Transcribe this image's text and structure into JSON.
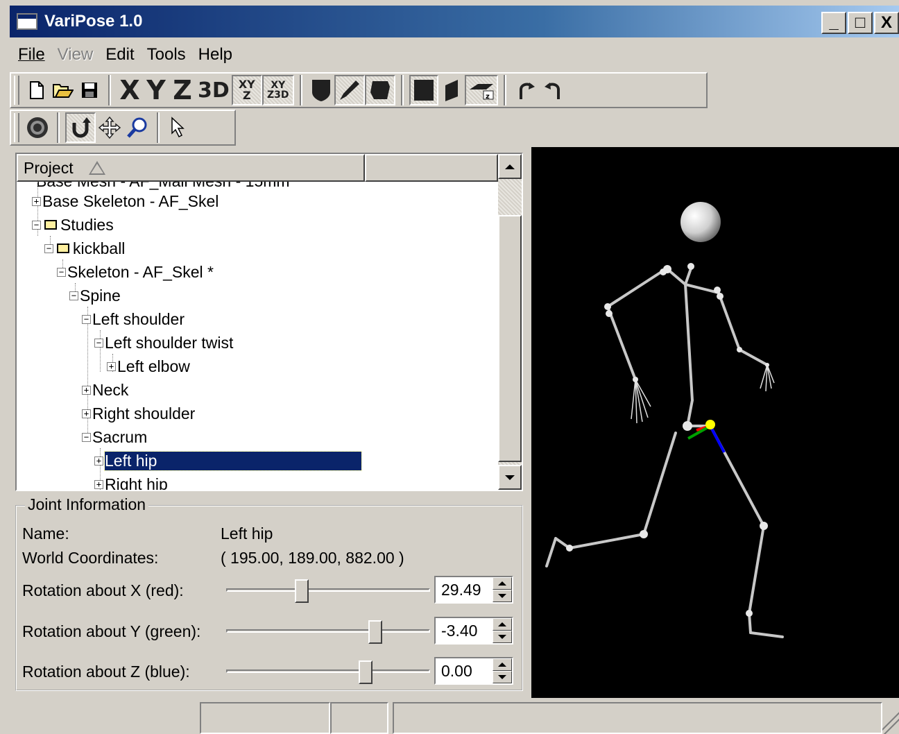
{
  "window": {
    "title": "VariPose 1.0",
    "controls": {
      "minimize": "_",
      "maximize": "□",
      "close": "X"
    }
  },
  "menu": {
    "items": [
      {
        "label": "File",
        "enabled": true
      },
      {
        "label": "View",
        "enabled": false
      },
      {
        "label": "Edit",
        "enabled": true
      },
      {
        "label": "Tools",
        "enabled": true
      },
      {
        "label": "Help",
        "enabled": true
      }
    ]
  },
  "toolbar1": {
    "axis_x": "X",
    "axis_y": "Y",
    "axis_z": "Z",
    "view_3d": "3D",
    "xy_z": "XY Z",
    "xy_3d": "XY Z3D",
    "icons": [
      "new-file-icon",
      "open-folder-icon",
      "save-icon",
      "shield-icon",
      "brush-icon",
      "blob-icon",
      "front-face-icon",
      "side-face-icon",
      "plane-z-icon",
      "undo-icon",
      "redo-icon"
    ]
  },
  "toolbar2": {
    "icons": [
      "target-icon",
      "rotate-icon",
      "move-icon",
      "zoom-icon",
      "select-arrow-icon"
    ],
    "active": "rotate-icon"
  },
  "project": {
    "column_header": "Project",
    "partial_row": "Base Mesh - AF_Mall Mesh - 15mm",
    "rows": [
      {
        "label": "Base Skeleton - AF_Skel",
        "box": "+",
        "folder": false
      },
      {
        "label": "Studies",
        "box": "−",
        "folder": true
      },
      {
        "label": "kickball",
        "box": "−",
        "folder": true
      },
      {
        "label": "Skeleton - AF_Skel *",
        "box": "−",
        "folder": false
      },
      {
        "label": "Spine",
        "box": "−",
        "folder": false
      },
      {
        "label": "Left shoulder",
        "box": "−",
        "folder": false
      },
      {
        "label": "Left shoulder twist",
        "box": "−",
        "folder": false
      },
      {
        "label": "Left elbow",
        "box": "+",
        "folder": false
      },
      {
        "label": "Neck",
        "box": "+",
        "folder": false
      },
      {
        "label": "Right shoulder",
        "box": "+",
        "folder": false
      },
      {
        "label": "Sacrum",
        "box": "−",
        "folder": false
      },
      {
        "label": "Left hip",
        "box": "+",
        "folder": false,
        "selected": true
      },
      {
        "label": "Right hip",
        "box": "+",
        "folder": false
      }
    ]
  },
  "joint_info": {
    "legend": "Joint Information",
    "name_label": "Name:",
    "name_value": "Left hip",
    "coords_label": "World Coordinates:",
    "coords_value": "( 195.00, 189.00, 882.00 )",
    "rotations": [
      {
        "label": "Rotation about X (red):",
        "value": "29.49",
        "slider_fraction": 0.36
      },
      {
        "label": "Rotation about Y (green):",
        "value": "-3.40",
        "slider_fraction": 0.75
      },
      {
        "label": "Rotation about Z (blue):",
        "value": "0.00",
        "slider_fraction": 0.7
      }
    ]
  },
  "colors": {
    "titlebar_start": "#0a246a",
    "selection": "#0a246a",
    "viewport_bg": "#000000",
    "bone": "#c8c8c8",
    "axis_x": "#ff0000",
    "axis_y": "#00a000",
    "axis_z": "#0000ff",
    "joint_marker": "#ffff00"
  }
}
